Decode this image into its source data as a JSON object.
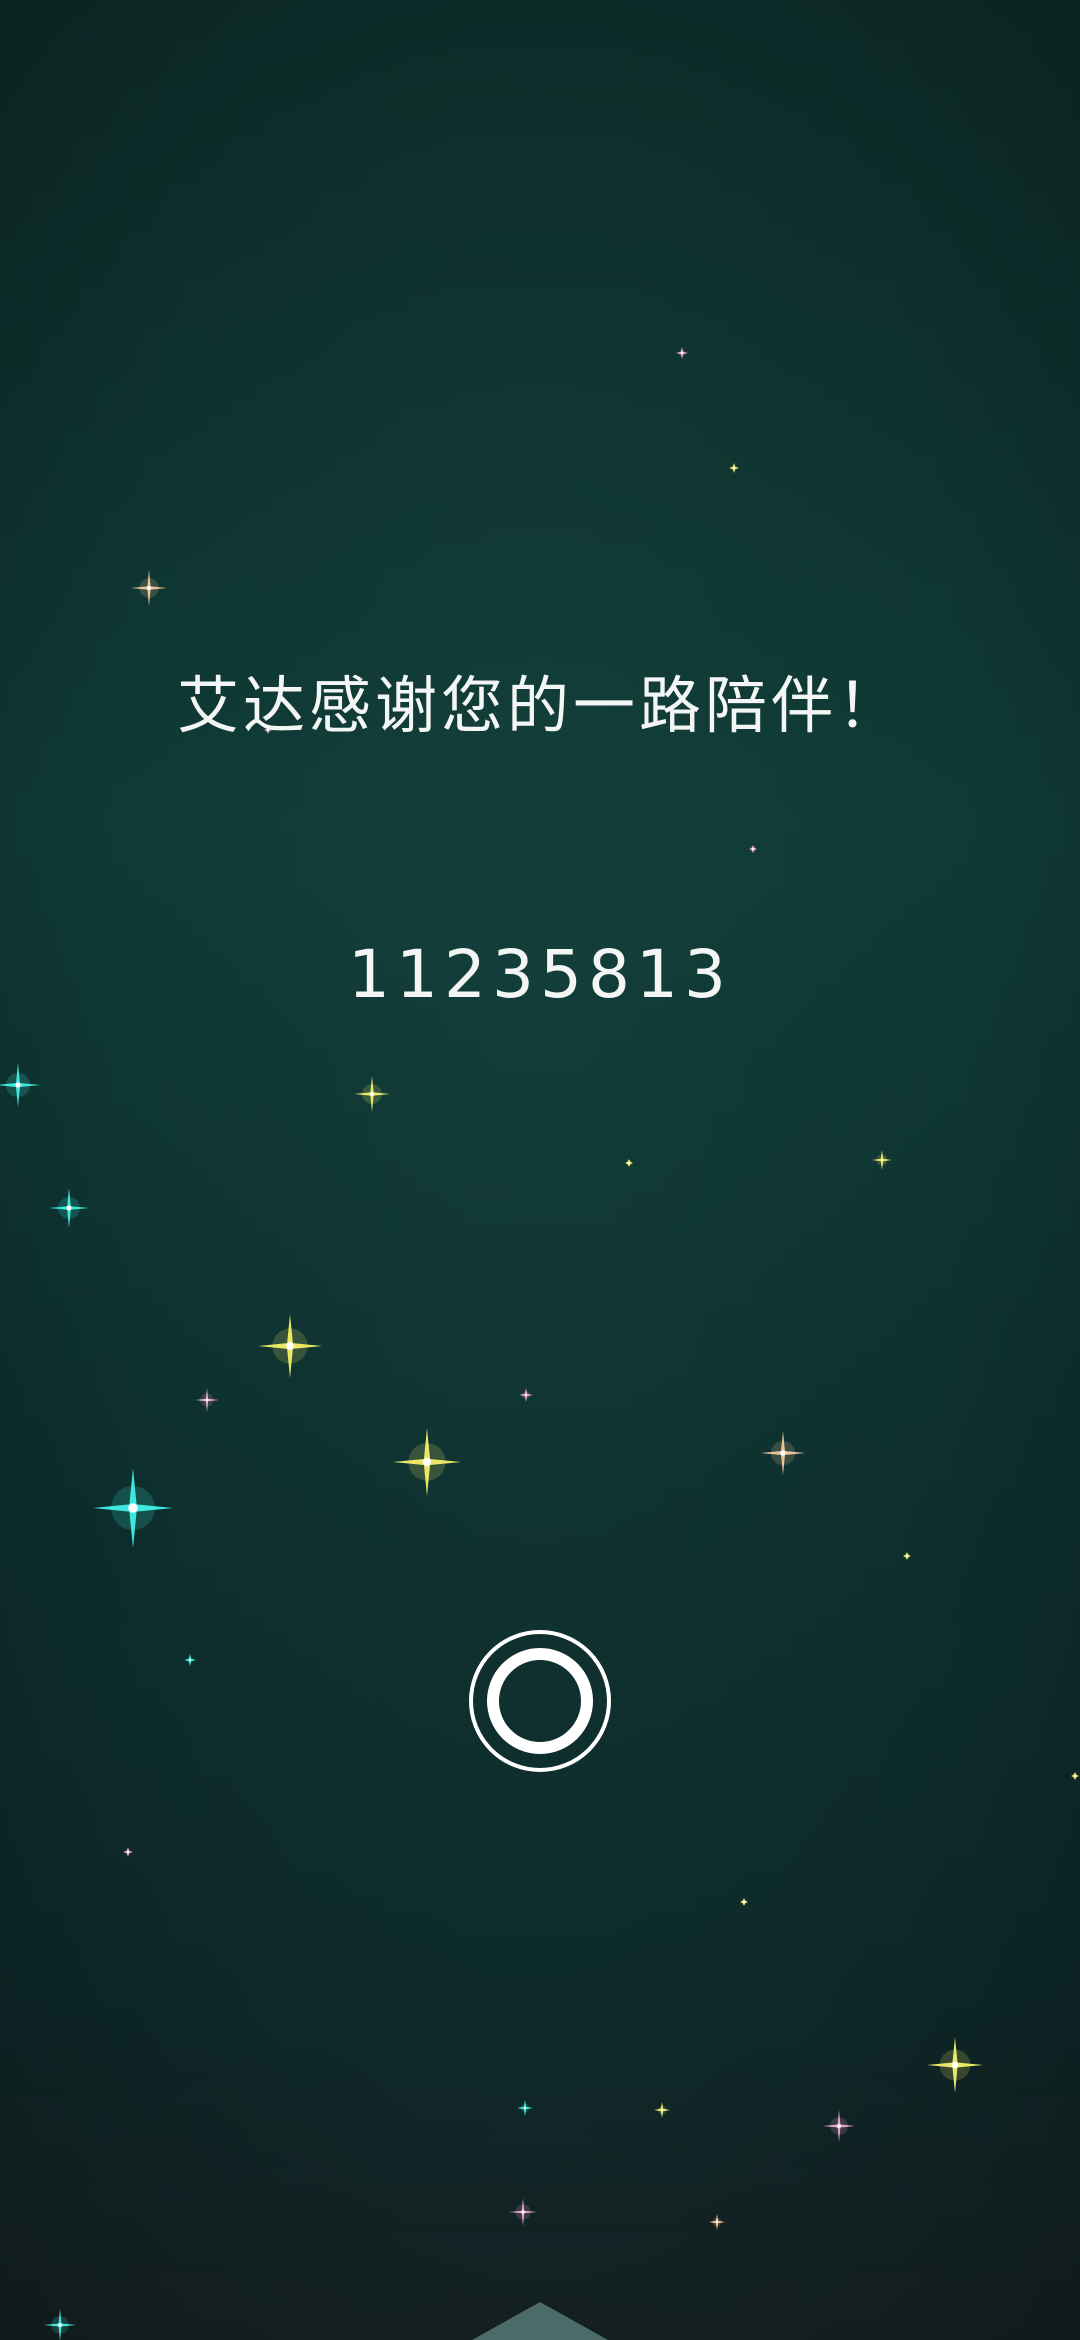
{
  "screen": {
    "message": "艾达感谢您的一路陪伴！",
    "code": "11235813"
  },
  "controls": {
    "ring_button_icon": "ring-icon",
    "bottom_arrow_icon": "up-arrow-icon"
  },
  "colors": {
    "background_top": "#0c2a27",
    "background_mid": "#0f3a36",
    "background_bottom": "#162224",
    "text": "#f4f6f5",
    "star_cyan": "#3ff0e6",
    "star_yellow": "#f4f06a",
    "star_peach": "#f7c89a",
    "star_pink": "#f0a6d6"
  }
}
